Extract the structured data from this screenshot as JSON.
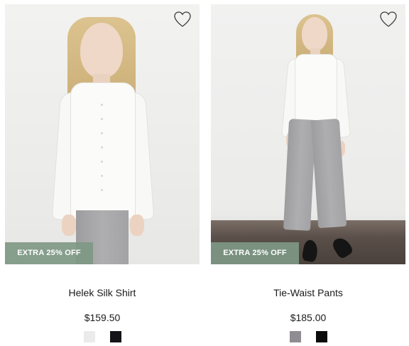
{
  "products": [
    {
      "name": "Helek Silk Shirt",
      "price": "$159.50",
      "badge": "EXTRA 25% OFF",
      "wishlist_icon": "heart-outline-icon",
      "swatches": [
        {
          "color": "#ebebeb"
        },
        {
          "color": "#141418"
        }
      ]
    },
    {
      "name": "Tie-Waist Pants",
      "price": "$185.00",
      "badge": "EXTRA 25% OFF",
      "wishlist_icon": "heart-outline-icon",
      "swatches": [
        {
          "color": "#8f8d92"
        },
        {
          "color": "#0b0b0b"
        }
      ]
    }
  ]
}
